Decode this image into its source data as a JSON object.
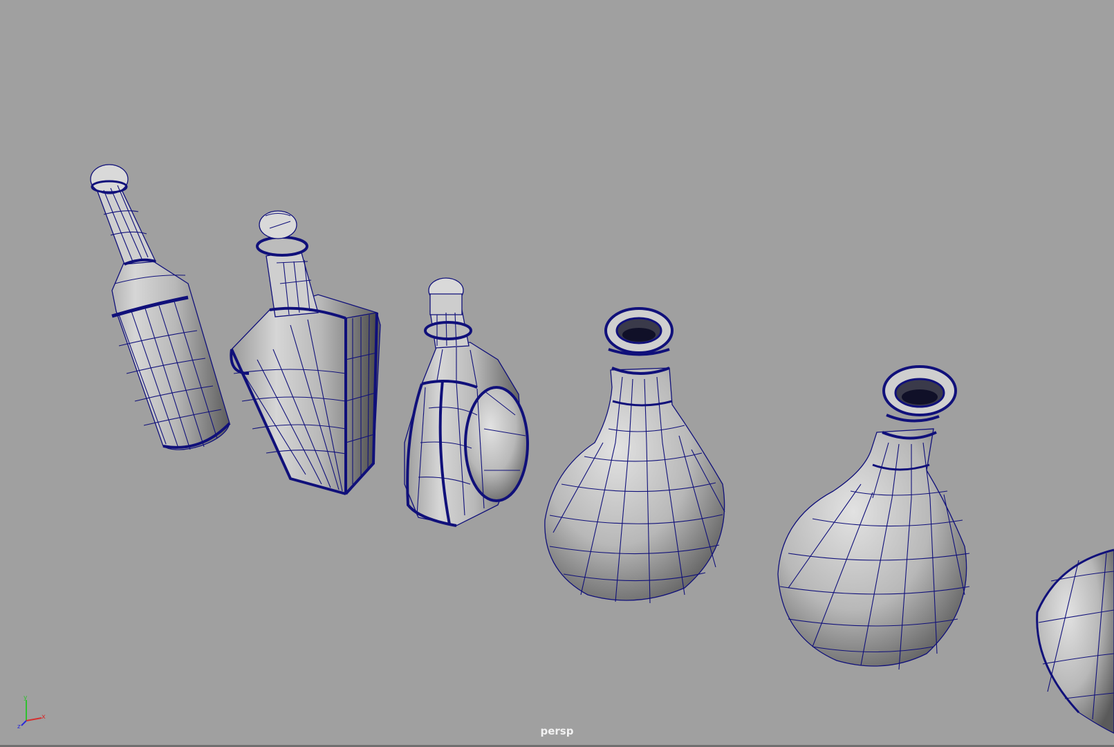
{
  "viewport": {
    "camera_name": "persp",
    "background_color": "#a0a0a0",
    "wireframe_color": "#10107a",
    "mode": "shaded-with-wireframe"
  },
  "axis_indicator": {
    "labels": {
      "x": "x",
      "y": "y",
      "z": "z"
    },
    "colors": {
      "x": "#d43030",
      "y": "#30c030",
      "z": "#2c2cd8"
    }
  },
  "scene_objects": [
    {
      "id": "bottle-1",
      "name": "tall-wine-bottle"
    },
    {
      "id": "bottle-2",
      "name": "square-whiskey-bottle"
    },
    {
      "id": "bottle-3",
      "name": "round-flask-bottle"
    },
    {
      "id": "bottle-4",
      "name": "bulb-decanter"
    },
    {
      "id": "bottle-5",
      "name": "bulb-decanter-large"
    },
    {
      "id": "bottle-6",
      "name": "partial-decanter"
    }
  ]
}
